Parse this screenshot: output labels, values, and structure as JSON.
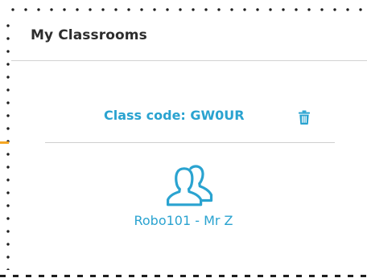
{
  "header": {
    "title": "My Classrooms"
  },
  "classroom": {
    "code_label": "Class code: GW0UR",
    "name": "Robo101 - Mr Z",
    "delete_icon": "trash-icon",
    "class_icon": "users-icon"
  },
  "colors": {
    "accent": "#2aa3d0",
    "title_text": "#2d2d2d",
    "divider": "#d2d2d2",
    "orange_marker": "#f5a623"
  }
}
